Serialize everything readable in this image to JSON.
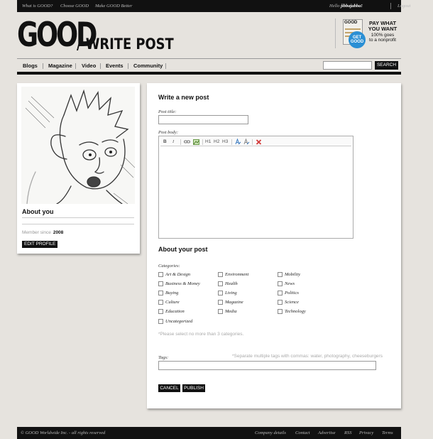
{
  "topbar": {
    "links": [
      "What is GOOD?",
      "Choose GOOD",
      "Make GOOD Better"
    ],
    "hello": "Hello",
    "username": "jibbajabba!",
    "logout": "Logout"
  },
  "header": {
    "logo": "GOOD",
    "page_title": "/ WRITE POST"
  },
  "promo": {
    "box_text": "GOOD",
    "badge": "GET GOOD",
    "line1": "PAY WHAT",
    "line2": "YOU WANT",
    "line3": "100% goes",
    "line4": "to a nonprofit"
  },
  "nav": {
    "items": [
      "Blogs",
      "Magazine",
      "Video",
      "Events",
      "Community"
    ],
    "search_button": "SEARCH",
    "search_value": ""
  },
  "profile": {
    "about_heading": "About you",
    "member_since_label": "Member since",
    "member_since_year": "2008",
    "edit_button": "EDIT PROFILE"
  },
  "form": {
    "heading": "Write a new post",
    "title_label": "Post title:",
    "title_value": "",
    "body_label": "Post body:",
    "toolbar": [
      "B",
      "I",
      "H1",
      "H2",
      "H3"
    ],
    "about_heading": "About your post",
    "categories_label": "Categories:",
    "categories": [
      "Art & Design",
      "Environment",
      "Mobility",
      "Business & Money",
      "Health",
      "News",
      "Buying",
      "Living",
      "Politics",
      "Culture",
      "Magazine",
      "Science",
      "Education",
      "Media",
      "Technology",
      "Uncategorized"
    ],
    "category_note": "*Please select no more than 3 categories.",
    "tags_label": "Tags:",
    "tags_note": "*Separate multiple tags with commas: water, photography, cheeseburgers",
    "tags_value": "",
    "cancel_button": "CANCEL",
    "publish_button": "PUBLISH"
  },
  "footer": {
    "copyright": "© GOOD Worldwide Inc. - all rights reserved",
    "links": [
      "Company details",
      "Contact",
      "Advertise",
      "RSS",
      "Privacy",
      "Terms"
    ]
  }
}
